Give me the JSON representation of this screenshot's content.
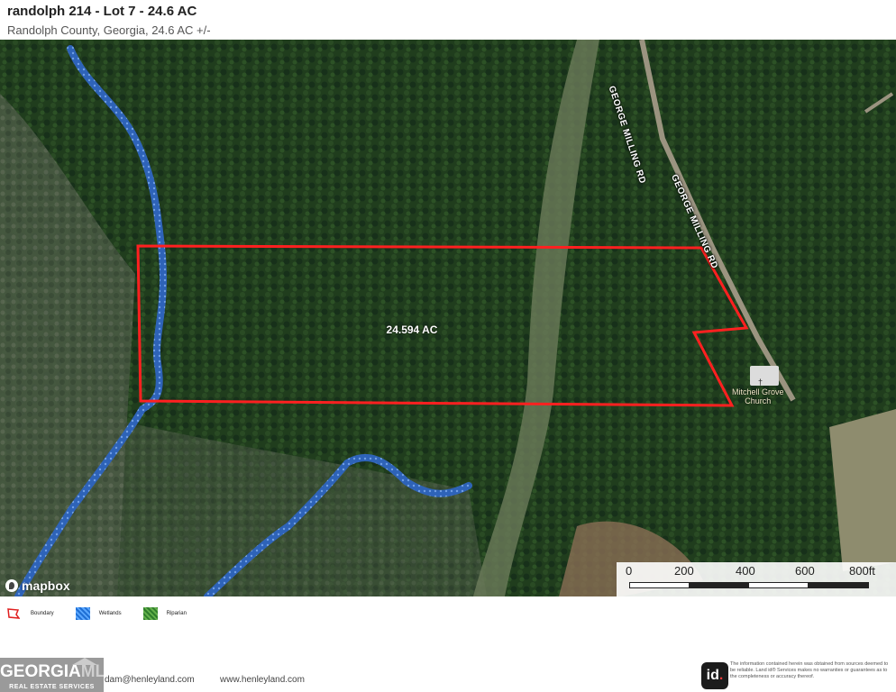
{
  "header": {
    "title": "randolph 214 - Lot 7 - 24.6 AC",
    "subtitle": "Randolph County, Georgia, 24.6 AC +/-"
  },
  "map": {
    "parcel_label": "24.594 AC",
    "road_label_1": "GEORGE MILLING RD",
    "road_label_2": "GEORGE MILLING RD",
    "church_label_line1": "Mitchell Grove",
    "church_label_line2": "Church",
    "church_icon_glyph": "†",
    "attribution": "mapbox",
    "colors": {
      "boundary": "#ff2020",
      "wetlands": "#2e63b8",
      "forest": "#1f3b1c"
    },
    "scalebar": {
      "ticks": [
        "0",
        "200",
        "400",
        "600",
        "800ft"
      ]
    }
  },
  "legend": {
    "items": [
      {
        "label": "Boundary",
        "icon": "boundary-icon"
      },
      {
        "label": "Wetlands",
        "icon": "wetlands-swatch"
      },
      {
        "label": "Riparian",
        "icon": "riparian-swatch"
      }
    ]
  },
  "footer": {
    "logo_text_a": "GEORGIA",
    "logo_text_b": "MLS",
    "logo_subtext": "REAL ESTATE SERVICES",
    "email": "dam@henleyland.com",
    "website": "www.henleyland.com",
    "id_logo_text": "id",
    "id_logo_dot": ".",
    "disclaimer": "The information contained herein was obtained from sources deemed to be reliable. Land id® Services makes no warranties or guarantees as to the completeness or accuracy thereof."
  }
}
